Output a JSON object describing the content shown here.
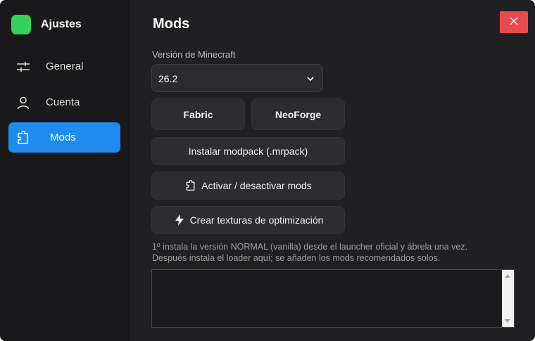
{
  "sidebar": {
    "title": "Ajustes",
    "items": [
      {
        "label": "General",
        "icon": "sliders-icon"
      },
      {
        "label": "Cuenta",
        "icon": "user-icon"
      },
      {
        "label": "Mods",
        "icon": "puzzle-icon",
        "active": true
      }
    ]
  },
  "main": {
    "title": "Mods",
    "version_label": "Versión de Minecraft",
    "version_value": "26.2",
    "buttons": {
      "fabric": "Fabric",
      "neoforge": "NeoForge",
      "install_modpack": "Instalar modpack (.mrpack)",
      "toggle_mods": "Activar / desactivar mods",
      "optimization": "Crear texturas de optimización"
    },
    "hint_line1": "1º instala la versión NORMAL (vanilla) desde el launcher oficial y ábrela una vez.",
    "hint_line2": "Después instala el loader aquí; se añaden los mods recomendados solos.",
    "log_text": ""
  },
  "colors": {
    "accent": "#1f8bef",
    "close": "#e74a4d",
    "logo": "#33d25c",
    "background": "#202023",
    "sidebar": "#19191b"
  }
}
